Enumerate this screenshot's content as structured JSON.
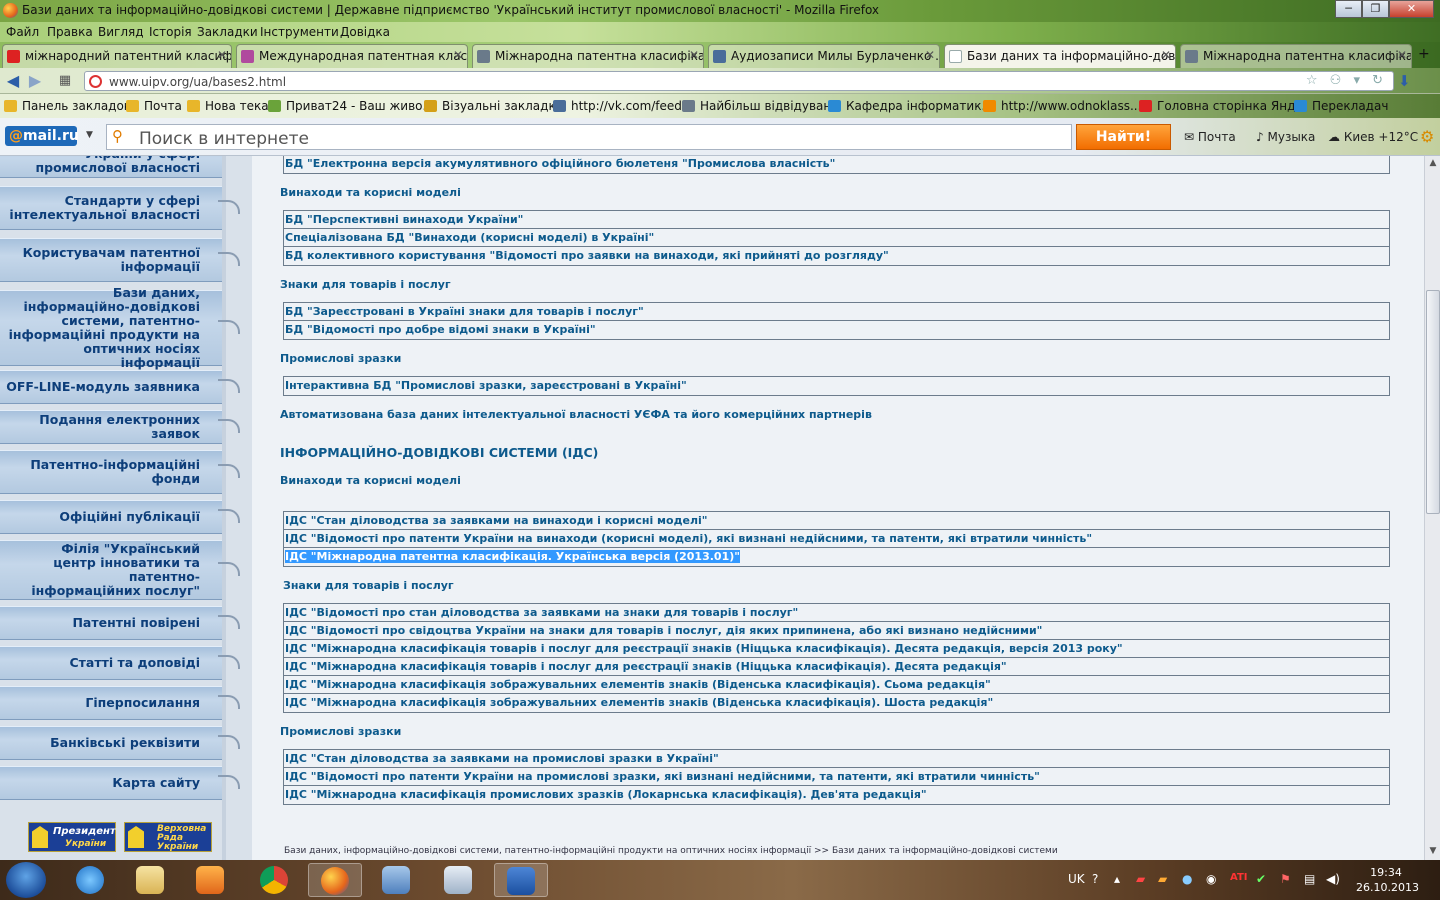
{
  "window": {
    "title": "Бази даних та інформаційно-довідкові системи | Державне підприємство 'Український інститут промислової власності' - Mozilla Firefox"
  },
  "menu": [
    "Файл",
    "Правка",
    "Вигляд",
    "Історія",
    "Закладки",
    "Інструменти",
    "Довідка"
  ],
  "tabs": [
    {
      "label": "міжнародний патентний класифі...",
      "icon_color": "#d22"
    },
    {
      "label": "Международная патентная класс...",
      "icon_color": "#b04a9e"
    },
    {
      "label": "Міжнародна патентна класифіка...",
      "icon_color": "#6a7a8a"
    },
    {
      "label": "Аудиозаписи Милы Бурлаченко ...",
      "icon_color": "#4a6d9a"
    },
    {
      "label": "Бази даних та інформаційно-дові...",
      "icon_color": "#9aa",
      "active": true
    },
    {
      "label": "Міжнародна патентна класифіка...",
      "icon_color": "#6a7a8a"
    }
  ],
  "nav": {
    "url": "www.uipv.org/ua/bases2.html"
  },
  "bookmarks": [
    {
      "label": "Панель закладок",
      "icon_color": "#e8b62a"
    },
    {
      "label": "Почта",
      "icon_color": "#e8b62a"
    },
    {
      "label": "Нова тека",
      "icon_color": "#e8b62a"
    },
    {
      "label": "Приват24 - Ваш живо...",
      "icon_color": "#6aa33a"
    },
    {
      "label": "Візуальні закладки",
      "icon_color": "#d4a017"
    },
    {
      "label": "http://vk.com/feed",
      "icon_color": "#4a6d9a"
    },
    {
      "label": "Найбільш відвідувані",
      "icon_color": "#6a7a8a"
    },
    {
      "label": "Кафедра інформатик...",
      "icon_color": "#2a8ad4"
    },
    {
      "label": "http://www.odnoklass...",
      "icon_color": "#f08a00"
    },
    {
      "label": "Головна сторінка Янд...",
      "icon_color": "#d22"
    },
    {
      "label": "Перекладач",
      "icon_color": "#2a8ad4"
    }
  ],
  "mailru": {
    "logo": "@mail.ru",
    "search_placeholder": "Поиск в интернете",
    "find_label": "Найти!",
    "mail_label": "Почта",
    "music_label": "Музыка",
    "weather_label": "Киев +12°C"
  },
  "sidebar": [
    {
      "label": "України у сфері промислової власності"
    },
    {
      "label": "Стандарти у сфері інтелектуальної власності"
    },
    {
      "label": "Користувачам патентної інформації"
    },
    {
      "label": "Бази даних, інформаційно-довідкові системи, патентно-інформаційні продукти на оптичних носіях інформації"
    },
    {
      "label": "OFF-LINE-модуль заявника"
    },
    {
      "label": "Подання електронних заявок"
    },
    {
      "label": "Патентно-інформаційні фонди"
    },
    {
      "label": "Офіційні публікації"
    },
    {
      "label": "Філія \"Український центр інноватики та патентно-інформаційних послуг\""
    },
    {
      "label": "Патентні повірені"
    },
    {
      "label": "Статті та доповіді"
    },
    {
      "label": "Гіперпосилання"
    },
    {
      "label": "Банківські реквізити"
    },
    {
      "label": "Карта сайту"
    }
  ],
  "badges": {
    "president": [
      "Президент",
      "України"
    ],
    "rada": [
      "Верховна",
      "Рада",
      "України"
    ]
  },
  "content": {
    "top_row": "БД \"Електронна версія акумулятивного офіційного бюлетеня \"Промислова власність\"",
    "db_inventions_heading": "Винаходи та корисні моделі",
    "db_inventions": [
      "БД \"Перспективні винаходи України\"",
      "Спеціалізована БД \"Винаходи (корисні моделі) в Україні\"",
      "БД колективного користування \"Відомості про заявки на винаходи, які прийняті до розгляду\""
    ],
    "db_marks_heading": "Знаки для товарів і послуг",
    "db_marks": [
      "БД \"Зареєстровані в Україні знаки для товарів і послуг\"",
      "БД \"Відомості про добре відомі знаки в Україні\""
    ],
    "db_designs_heading": "Промислові зразки",
    "db_designs": [
      "Інтерактивна БД \"Промислові зразки, зареєстровані в Україні\""
    ],
    "uefa_line": "Автоматизована база даних інтелектуальної власності УЄФА та його комерційних партнерів",
    "ids_heading": "ІНФОРМАЦІЙНО-ДОВІДКОВІ СИСТЕМИ (ІДС)",
    "ids_inventions_heading": "Винаходи та корисні моделі",
    "ids_inventions": [
      "ІДС \"Стан діловодства за заявками на винаходи і корисні моделі\"",
      "ІДС \"Відомості про патенти України на винаходи (корисні моделі), які визнані недійсними, та патенти, які втратили чинність\"",
      "ІДС \"Міжнародна патентна класифікація. Українська версія (2013.01)\""
    ],
    "ids_marks_heading": "Знаки для товарів і послуг",
    "ids_marks": [
      "ІДС \"Відомості про стан діловодства за заявками на знаки для товарів і послуг\"",
      "ІДС \"Відомості про свідоцтва України на знаки для товарів і послуг, дія яких припинена, або які визнано недійсними\"",
      "ІДС \"Міжнародна класифікація товарів і послуг для реєстрації знаків (Ніццька класифікація). Десята редакція, версія 2013 року\"",
      "ІДС \"Міжнародна класифікація товарів і послуг для реєстрації знаків (Ніццька класифікація). Десята редакція\"",
      "ІДС \"Міжнародна класифікація зображувальних елементів знаків (Віденська класифікація). Сьома редакція\"",
      "ІДС \"Міжнародна класифікація зображувальних елементів знаків (Віденська класифікація). Шоста редакція\""
    ],
    "ids_designs_heading": "Промислові зразки",
    "ids_designs": [
      "ІДС \"Стан діловодства за заявками на промислові зразки в Україні\"",
      "ІДС \"Відомості про патенти України на промислові зразки, які визнані недійсними, та патенти, які втратили чинність\"",
      "ІДС \"Міжнародна класифікація промислових зразків (Локарнська класифікація). Дев'ята редакція\""
    ],
    "breadcrumb_1": "Бази даних, інформаційно-довідкові системи, патентно-інформаційні продукти на оптичних носіях інформації",
    "breadcrumb_sep": ">>",
    "breadcrumb_2": "Бази даних та інформаційно-довідкові системи"
  },
  "taskbar": {
    "lang": "UK",
    "time": "19:34",
    "date": "26.10.2013"
  }
}
